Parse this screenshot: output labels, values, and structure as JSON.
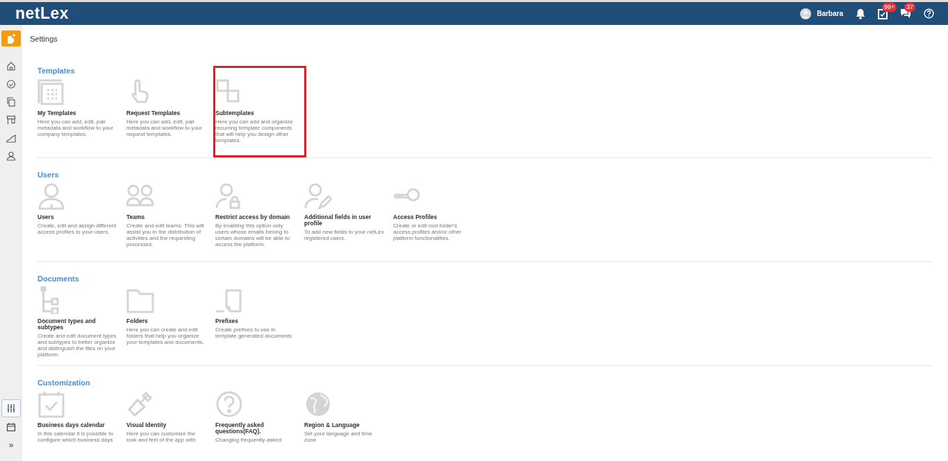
{
  "header": {
    "logo": "netLex",
    "user": "Barbara",
    "badges": [
      {
        "count": "99+"
      },
      {
        "count": "37"
      }
    ]
  },
  "sidebar": {
    "items": [
      {
        "selected": false
      },
      {
        "selected": false
      },
      {
        "selected": false
      },
      {
        "selected": false
      },
      {
        "selected": false
      },
      {
        "selected": false
      }
    ],
    "bottom": [
      {
        "selected": true
      },
      {
        "selected": false
      }
    ],
    "expand": "»"
  },
  "page_title": "Settings",
  "sections": [
    {
      "title": "Templates",
      "items": [
        {
          "title": "My Templates",
          "description": "Here you can add, edit, pair metadata and workflow to your company templates.",
          "highlighted": false
        },
        {
          "title": "Request Templates",
          "description": "Here you can add, edit, pair metadata and workflow to your request templates.",
          "highlighted": false
        },
        {
          "title": "Subtemplates",
          "description": "Here you can add and organize recurring template components that will help you design other templates.",
          "highlighted": true
        }
      ]
    },
    {
      "title": "Users",
      "items": [
        {
          "title": "Users",
          "description": "Create, edit and assign different access profiles to your users.",
          "highlighted": false
        },
        {
          "title": "Teams",
          "description": "Create and edit teams. This will assist you in the distribution of activities and the requesting processes.",
          "highlighted": false
        },
        {
          "title": "Restrict access by domain",
          "description": "By enabling this option only users whose emails belong to certain domains will be able to access the platform.",
          "highlighted": false
        },
        {
          "title": "Additional fields in user profile",
          "description": "To add new fields to your netLex registered users.",
          "highlighted": false
        },
        {
          "title": "Access Profiles",
          "description": "Create or edit root folder's access profiles and/or other platform functionalities.",
          "highlighted": false
        }
      ]
    },
    {
      "title": "Documents",
      "items": [
        {
          "title": "Document types and subtypes",
          "description": "Create and edit document types and subtypes to better organize and distinguish the files on your platform.",
          "highlighted": false
        },
        {
          "title": "Folders",
          "description": "Here you can create and edit folders that help you organize your templates and documents.",
          "highlighted": false
        },
        {
          "title": "Prefixes",
          "description": "Create prefixes to use in template generated documents",
          "highlighted": false
        }
      ]
    },
    {
      "title": "Customization",
      "items": [
        {
          "title": "Business days calendar",
          "description": "In this calendar it is possible to configure which business days",
          "highlighted": false
        },
        {
          "title": "Visual Identity",
          "description": "Here you can customize the look and feel of the app with",
          "highlighted": false
        },
        {
          "title": "Frequently asked questions(FAQ).",
          "description": "Changing frequently asked",
          "highlighted": false
        },
        {
          "title": "Region & Language",
          "description": "Set your language and time zone",
          "highlighted": false
        }
      ]
    }
  ]
}
